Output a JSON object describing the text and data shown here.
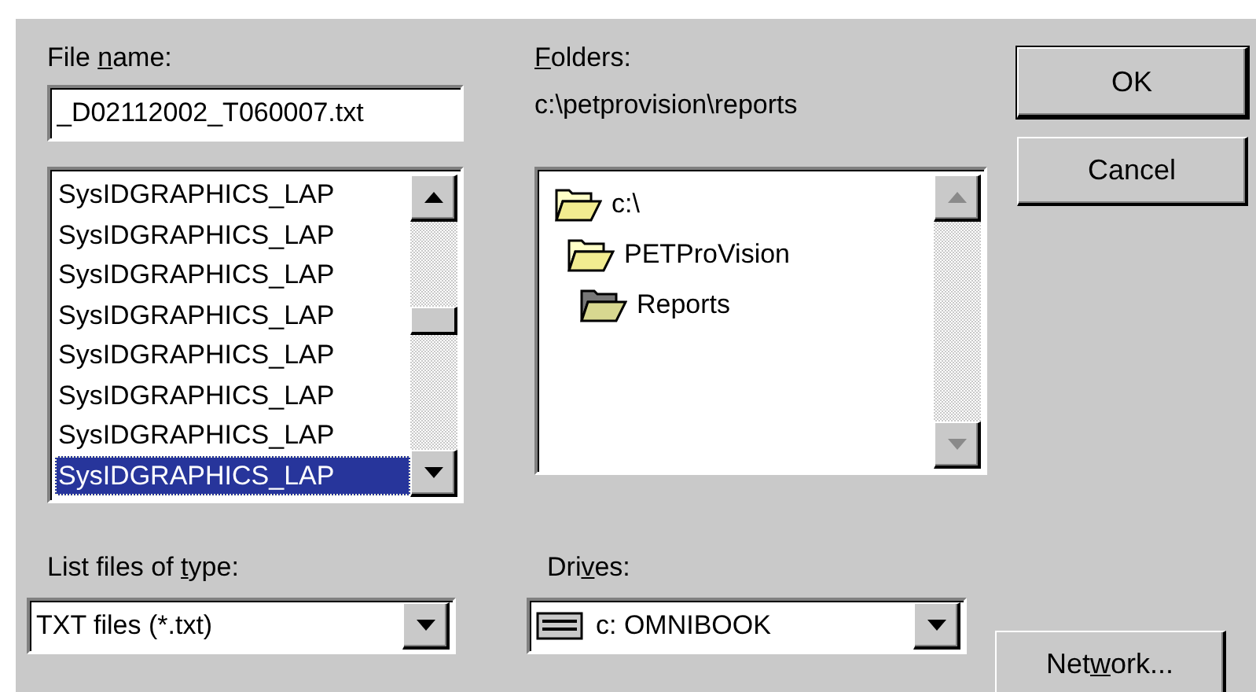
{
  "file_name": {
    "label": {
      "before": "File ",
      "key": "n",
      "after": "ame:"
    },
    "value": "_D02112002_T060007.txt"
  },
  "files": [
    {
      "name": "SysIDGRAPHICS_LAP",
      "selected": false
    },
    {
      "name": "SysIDGRAPHICS_LAP",
      "selected": false
    },
    {
      "name": "SysIDGRAPHICS_LAP",
      "selected": false
    },
    {
      "name": "SysIDGRAPHICS_LAP",
      "selected": false
    },
    {
      "name": "SysIDGRAPHICS_LAP",
      "selected": false
    },
    {
      "name": "SysIDGRAPHICS_LAP",
      "selected": false
    },
    {
      "name": "SysIDGRAPHICS_LAP",
      "selected": false
    },
    {
      "name": "SysIDGRAPHICS_LAP",
      "selected": true
    }
  ],
  "folders": {
    "label": {
      "key": "F",
      "after": "olders:"
    },
    "path": "c:\\petprovision\\reports",
    "tree": [
      {
        "name": "c:\\",
        "current": false,
        "children": [
          {
            "name": "PETProVision",
            "current": false,
            "children": [
              {
                "name": "Reports",
                "current": true
              }
            ]
          }
        ]
      }
    ]
  },
  "file_type": {
    "label": {
      "before": "List files of ",
      "key": "t",
      "after": "ype:"
    },
    "value": "TXT files (*.txt)"
  },
  "drives": {
    "label": {
      "before": "Dri",
      "key": "v",
      "after": "es:"
    },
    "value": "c: OMNIBOOK"
  },
  "buttons": [
    {
      "label": {
        "before": "OK"
      },
      "default": true
    },
    {
      "label": {
        "before": "Cancel"
      },
      "default": false
    },
    {
      "label": {
        "before": "Net",
        "key": "w",
        "after": "ork..."
      },
      "default": false
    }
  ]
}
